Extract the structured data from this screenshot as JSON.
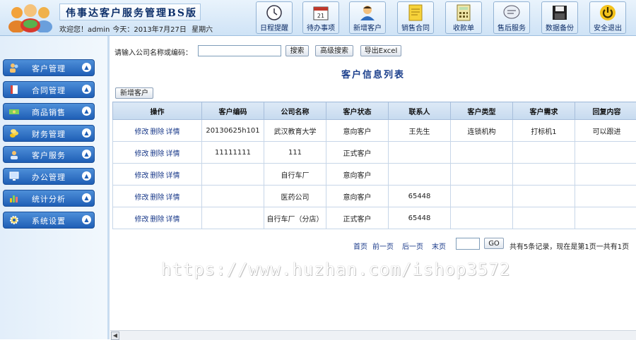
{
  "header": {
    "title": "伟事达客户服务管理BS版",
    "welcome": "欢迎您！admin",
    "today_label": "今天：2013年7月27日",
    "weekday": "星期六",
    "toolbar": [
      {
        "label": "日程提醒",
        "icon": "clock-icon"
      },
      {
        "label": "待办事项",
        "icon": "calendar-icon"
      },
      {
        "label": "新增客户",
        "icon": "user-add-icon"
      },
      {
        "label": "销售合同",
        "icon": "notepad-icon"
      },
      {
        "label": "收款单",
        "icon": "calculator-icon"
      },
      {
        "label": "售后服务",
        "icon": "chat-bubble-icon"
      },
      {
        "label": "数据备份",
        "icon": "floppy-disk-icon"
      },
      {
        "label": "安全退出",
        "icon": "power-icon"
      }
    ]
  },
  "sidebar": {
    "items": [
      {
        "label": "客户管理",
        "icon": "people-icon"
      },
      {
        "label": "合同管理",
        "icon": "document-icon"
      },
      {
        "label": "商品销售",
        "icon": "money-icon"
      },
      {
        "label": "财务管理",
        "icon": "coins-icon"
      },
      {
        "label": "客户服务",
        "icon": "service-icon"
      },
      {
        "label": "办公管理",
        "icon": "monitor-icon"
      },
      {
        "label": "统计分析",
        "icon": "chart-icon"
      },
      {
        "label": "系统设置",
        "icon": "gear-icon"
      }
    ]
  },
  "search": {
    "label": "请输入公司名称或编码：",
    "value": "",
    "search_button": "搜索",
    "advanced_button": "高级搜索",
    "export_button": "导出Excel"
  },
  "list": {
    "title": "客户信息列表",
    "add_button": "新增客户",
    "columns": [
      "操作",
      "客户编码",
      "公司名称",
      "客户状态",
      "联系人",
      "客户类型",
      "客户需求",
      "回复内容"
    ],
    "actions": [
      "修改",
      "删除",
      "详情"
    ],
    "rows": [
      {
        "code": "20130625h101",
        "company": "武汉教育大学",
        "status": "意向客户",
        "contact": "王先生",
        "type": "连锁机构",
        "need": "打标机1",
        "reply": "可以跟进"
      },
      {
        "code": "11111111",
        "company": "111",
        "status": "正式客户",
        "contact": "",
        "type": "",
        "need": "",
        "reply": ""
      },
      {
        "code": "",
        "company": "自行车厂",
        "status": "意向客户",
        "contact": "",
        "type": "",
        "need": "",
        "reply": ""
      },
      {
        "code": "",
        "company": "医药公司",
        "status": "意向客户",
        "contact": "65448",
        "type": "",
        "need": "",
        "reply": ""
      },
      {
        "code": "",
        "company": "自行车厂（分店）",
        "status": "正式客户",
        "contact": "65448",
        "type": "",
        "need": "",
        "reply": ""
      }
    ]
  },
  "pager": {
    "first": "首页",
    "prev": "前一页",
    "next": "后一页",
    "last": "末页",
    "page_value": "",
    "go_button": "GO",
    "info": "共有5条记录，现在是第1页一共有1页"
  },
  "watermark": "https://www.huzhan.com/ishop3572",
  "colors": {
    "accent": "#1f5fb6",
    "header_bg": "#d7e8f8",
    "title": "#1b3f8c"
  }
}
